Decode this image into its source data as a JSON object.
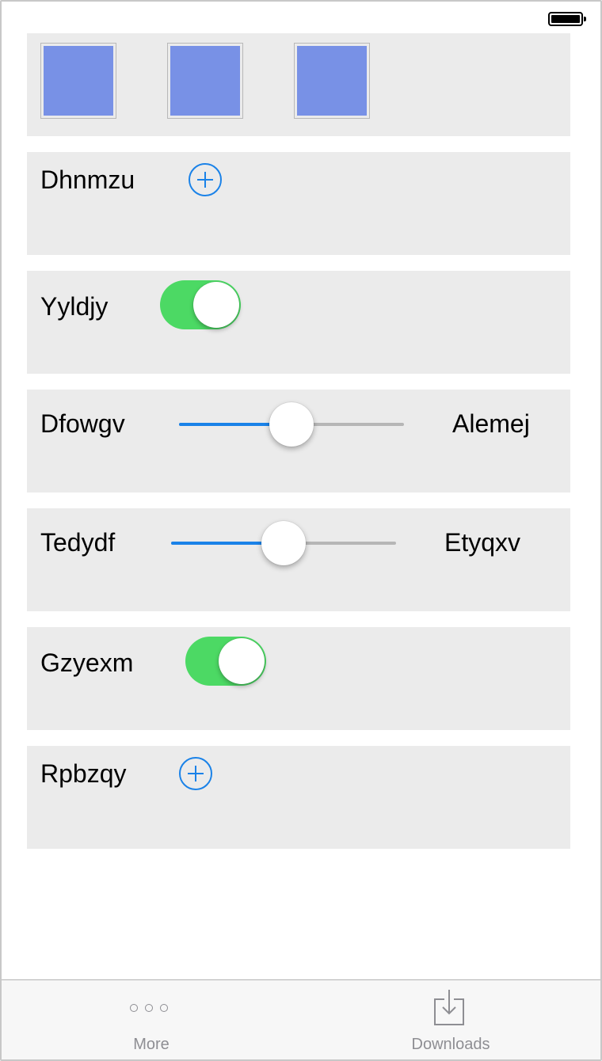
{
  "status_bar": {
    "battery_icon": "battery-full-icon"
  },
  "rows": {
    "tiles": {
      "count": 3,
      "color": "#7891e6"
    },
    "dhnmzu": {
      "label": "Dhnmzu",
      "icon": "add-circle-icon"
    },
    "yyldjy": {
      "label": "Yyldjy",
      "toggle_on": true
    },
    "dfowgv": {
      "label": "Dfowgv",
      "end_label": "Alemej",
      "slider_value": 0.5
    },
    "tedydf": {
      "label": "Tedydf",
      "end_label": "Etyqxv",
      "slider_value": 0.5
    },
    "gzyexm": {
      "label": "Gzyexm",
      "toggle_on": true
    },
    "rpbzqy": {
      "label": "Rpbzqy",
      "icon": "add-circle-icon"
    }
  },
  "tab_bar": {
    "tabs": [
      {
        "label": "More",
        "icon": "more-dots-icon"
      },
      {
        "label": "Downloads",
        "icon": "download-tray-icon"
      }
    ]
  },
  "colors": {
    "accent": "#1a82e8",
    "toggle_on": "#4cd964",
    "card_background": "#ebebeb",
    "tab_inactive": "#8e8e93"
  }
}
